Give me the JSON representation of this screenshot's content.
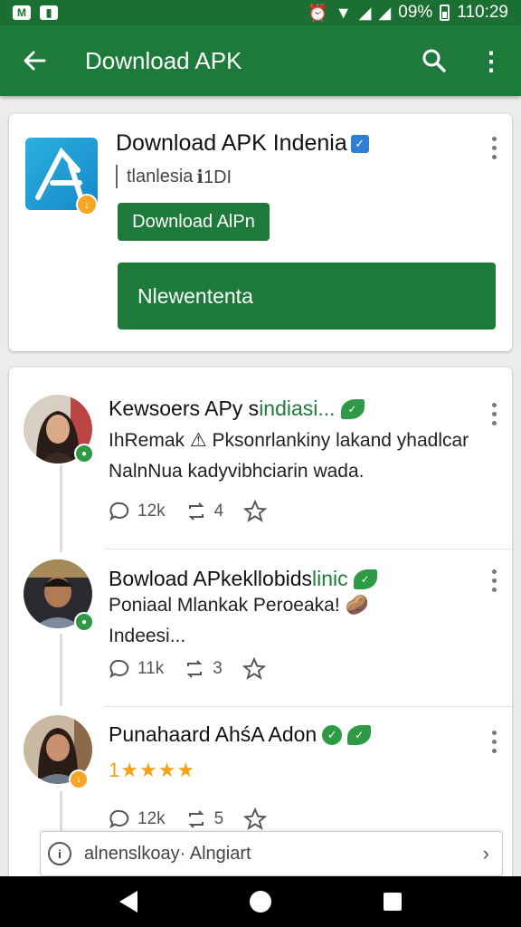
{
  "status_bar": {
    "battery": "09%",
    "time": "110:29"
  },
  "app_bar": {
    "title": "Download APK"
  },
  "app_card": {
    "name": "Download APK  Indenia",
    "subtitle": "tlanlesia",
    "subtitle_meta": "ℹ1DI",
    "small_button": "Download AlPn",
    "big_button": "Nlewententa"
  },
  "posts": [
    {
      "title_main": "Kewsoers APy s ",
      "title_green": "indiasi...",
      "line1": "IhRemak ⚠ Pksonrlankiny lakand yhadlcar",
      "line2": "NalnNua kadyvibhciarin wada.",
      "comments": "12k",
      "reposts": "4"
    },
    {
      "title_main": "Bowload APkekllobids",
      "title_green": "linic",
      "line1": "Poniaal Mlankak Peroeaka! 🥔",
      "line2": "Indeesi...",
      "comments": "11k",
      "reposts": "3"
    },
    {
      "title_main": "Punahaard AhśA Adon",
      "title_green": "",
      "rating_prefix": "1",
      "rating_stars": "★★★★",
      "comments": "12k",
      "reposts": "5"
    }
  ],
  "composer": {
    "placeholder": "alnenslkoay· Alngiart"
  },
  "colors": {
    "primary": "#1e7a3a",
    "status": "#1b6f33",
    "accent_star": "#f2a21a"
  }
}
